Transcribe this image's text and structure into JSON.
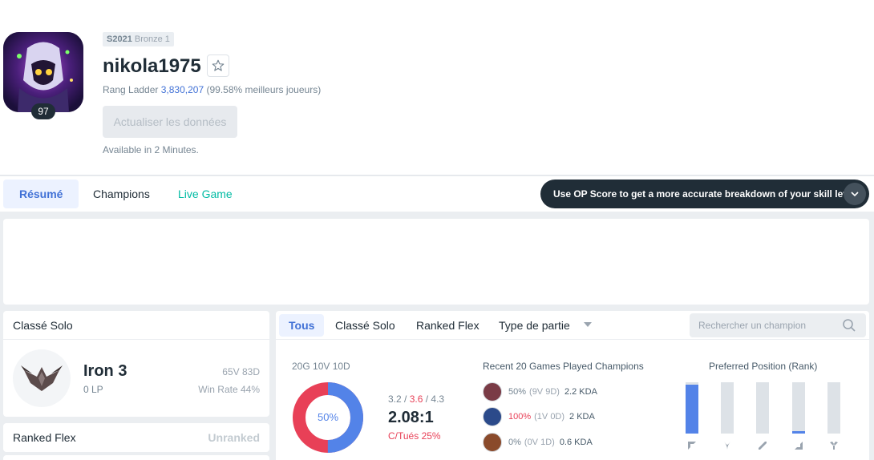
{
  "header": {
    "season": "S2021",
    "season_tier": "Bronze 1",
    "summoner_name": "nikola1975",
    "level": "97",
    "ladder_prefix": "Rang Ladder",
    "ladder_rank": "3,830,207",
    "ladder_percent": "(99.58% meilleurs joueurs)",
    "refresh_label": "Actualiser les données",
    "available_text": "Available in 2 Minutes.",
    "favorite_icon": "star-icon"
  },
  "nav": {
    "tabs": [
      "Résumé",
      "Champions",
      "Live Game"
    ],
    "active": "Résumé",
    "op_banner": "Use OP Score to get a more accurate breakdown of your skill level."
  },
  "solo": {
    "title": "Classé Solo",
    "tier": "Iron 3",
    "lp": "0 LP",
    "record": "65V 83D",
    "win_rate": "Win Rate 44%"
  },
  "flex": {
    "title": "Ranked Flex",
    "status": "Unranked"
  },
  "matches": {
    "filters": [
      "Tous",
      "Classé Solo",
      "Ranked Flex",
      "Type de partie"
    ],
    "search_placeholder": "Rechercher un champion",
    "summary": "20G 10V 10D",
    "win_percent": 50,
    "win_percent_label": "50%",
    "kills": "3.2",
    "deaths": "3.6",
    "assists": "4.3",
    "kda_ratio": "2.08:1",
    "kill_participation": "C/Tués 25%",
    "colors": {
      "win": "#5383e8",
      "loss": "#e84057"
    },
    "recent_title": "Recent 20 Games Played Champions",
    "recent_champions": [
      {
        "win_rate": "50%",
        "record": "(9V 9D)",
        "kda": "2.2 KDA",
        "hot": false
      },
      {
        "win_rate": "100%",
        "record": "(1V 0D)",
        "kda": "2 KDA",
        "hot": true
      },
      {
        "win_rate": "0%",
        "record": "(0V 1D)",
        "kda": "0.6 KDA",
        "hot": false
      }
    ],
    "preferred_title": "Preferred Position (Rank)",
    "positions": [
      {
        "name": "top",
        "share": 0.95
      },
      {
        "name": "jungle",
        "share": 0
      },
      {
        "name": "mid",
        "share": 0
      },
      {
        "name": "adc",
        "share": 0.05
      },
      {
        "name": "support",
        "share": 0
      }
    ]
  }
}
